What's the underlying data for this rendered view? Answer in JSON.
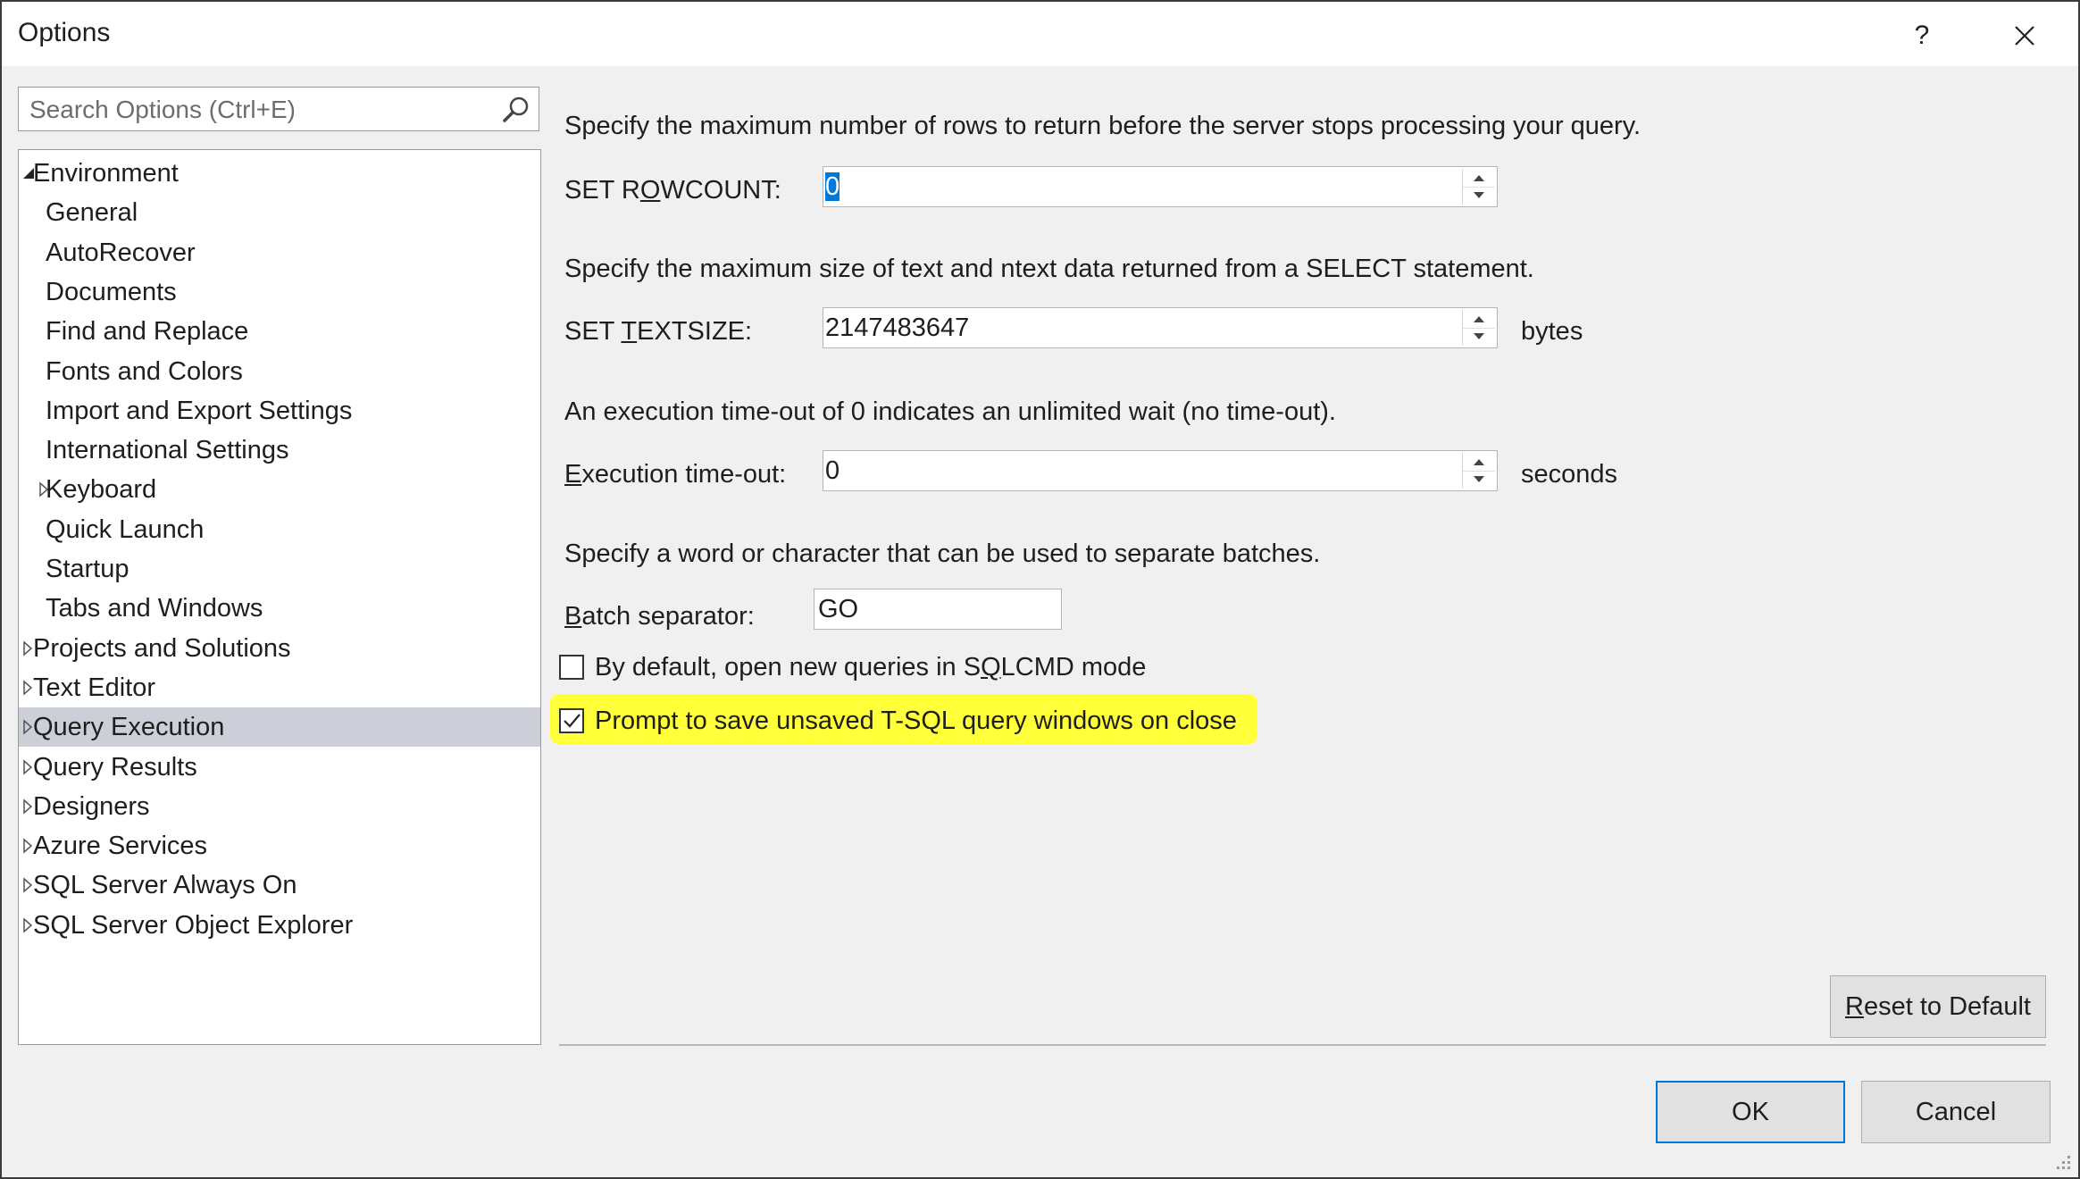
{
  "window": {
    "title": "Options",
    "help_label": "?",
    "close_label": "✕"
  },
  "search": {
    "placeholder": "Search Options (Ctrl+E)"
  },
  "tree": {
    "items": [
      {
        "label": "Environment",
        "level": 0,
        "expander": "expanded"
      },
      {
        "label": "General",
        "level": 1,
        "expander": "none"
      },
      {
        "label": "AutoRecover",
        "level": 1,
        "expander": "none"
      },
      {
        "label": "Documents",
        "level": 1,
        "expander": "none"
      },
      {
        "label": "Find and Replace",
        "level": 1,
        "expander": "none"
      },
      {
        "label": "Fonts and Colors",
        "level": 1,
        "expander": "none"
      },
      {
        "label": "Import and Export Settings",
        "level": 1,
        "expander": "none"
      },
      {
        "label": "International Settings",
        "level": 1,
        "expander": "none"
      },
      {
        "label": "Keyboard",
        "level": 1,
        "expander": "collapsed"
      },
      {
        "label": "Quick Launch",
        "level": 1,
        "expander": "none"
      },
      {
        "label": "Startup",
        "level": 1,
        "expander": "none"
      },
      {
        "label": "Tabs and Windows",
        "level": 1,
        "expander": "none"
      },
      {
        "label": "Projects and Solutions",
        "level": 0,
        "expander": "collapsed"
      },
      {
        "label": "Text Editor",
        "level": 0,
        "expander": "collapsed"
      },
      {
        "label": "Query Execution",
        "level": 0,
        "expander": "collapsed",
        "selected": true
      },
      {
        "label": "Query Results",
        "level": 0,
        "expander": "collapsed"
      },
      {
        "label": "Designers",
        "level": 0,
        "expander": "collapsed"
      },
      {
        "label": "Azure Services",
        "level": 0,
        "expander": "collapsed"
      },
      {
        "label": "SQL Server Always On",
        "level": 0,
        "expander": "collapsed"
      },
      {
        "label": "SQL Server Object Explorer",
        "level": 0,
        "expander": "collapsed"
      }
    ]
  },
  "settings": {
    "rowcount": {
      "description": "Specify the maximum number of rows to return before the server stops processing your query.",
      "label_pre": "SET R",
      "label_key": "O",
      "label_post": "WCOUNT:",
      "value": "0"
    },
    "textsize": {
      "description": "Specify the maximum size of text and ntext data returned from a SELECT statement.",
      "label_pre": "SET ",
      "label_key": "T",
      "label_post": "EXTSIZE:",
      "value": "2147483647",
      "unit": "bytes"
    },
    "timeout": {
      "description": "An execution time-out of 0 indicates an unlimited wait (no time-out).",
      "label_pre": "",
      "label_key": "E",
      "label_post": "xecution time-out:",
      "value": "0",
      "unit": "seconds"
    },
    "batch": {
      "description": "Specify a word or character that can be used to separate batches.",
      "label_pre": "",
      "label_key": "B",
      "label_post": "atch separator:",
      "value": "GO"
    },
    "sqlcmd": {
      "label_pre": "By default, open new queries in S",
      "label_key": "Q",
      "label_post": "LCMD mode",
      "checked": false
    },
    "prompt_save": {
      "label": "Prompt to save unsaved T-SQL query windows on close",
      "checked": true,
      "highlight_color": "#ffff3a"
    }
  },
  "buttons": {
    "reset_pre": "",
    "reset_key": "R",
    "reset_post": "eset to Default",
    "ok": "OK",
    "cancel": "Cancel"
  },
  "colors": {
    "accent": "#0078d7",
    "selection": "#ccced8"
  }
}
